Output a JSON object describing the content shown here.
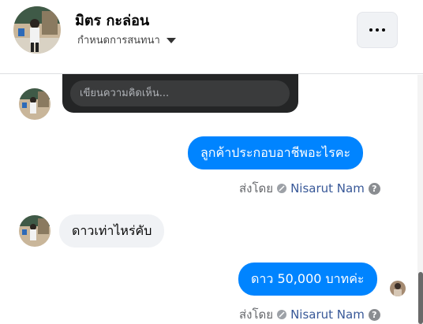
{
  "header": {
    "name": "มิตร กะล่อน",
    "subtitle": "กำหนดการสนทนา"
  },
  "shared_card": {
    "comment_placeholder": "เขียนความคิดเห็น..."
  },
  "messages": [
    {
      "direction": "outgoing",
      "text": "ลูกค้าประกอบอาชีพอะไรคะ"
    },
    {
      "direction": "incoming",
      "text": "ดาวเท่าไหร่คับ"
    },
    {
      "direction": "outgoing",
      "text": "ดาว 50,000 บาทค่ะ"
    }
  ],
  "sent_by": {
    "prefix": "ส่งโดย",
    "name": "Nisarut Nam",
    "help": "?"
  },
  "colors": {
    "accent": "#0084ff",
    "incoming_bubble": "#f0f2f5",
    "card_bg": "#242526"
  },
  "icons": [
    "more-horizontal-icon",
    "chevron-down-icon",
    "page-badge-icon",
    "help-icon"
  ]
}
